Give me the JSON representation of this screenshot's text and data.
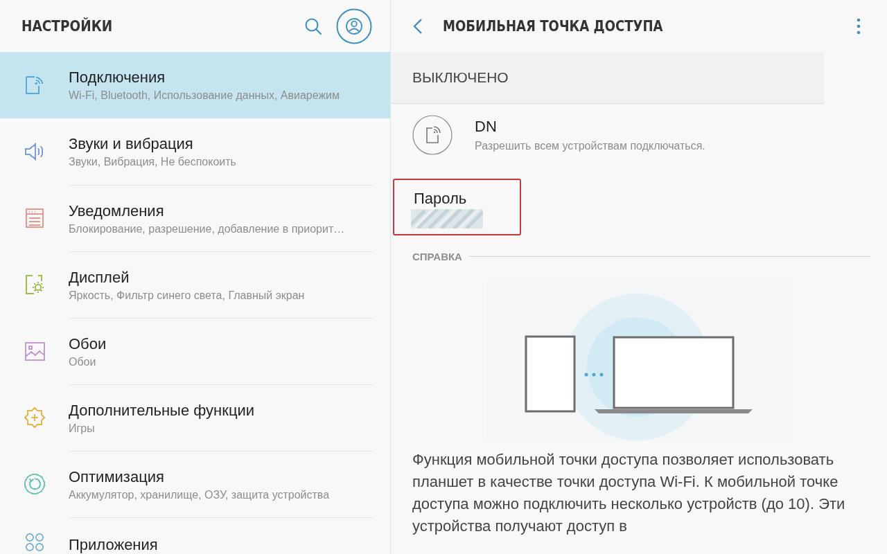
{
  "header": {
    "title": "НАСТРОЙКИ"
  },
  "sidebar": {
    "items": [
      {
        "kind": "connections",
        "title": "Подключения",
        "subtitle": "Wi-Fi, Bluetooth, Использование данных, Авиарежим",
        "color": "#5aa9d6",
        "selected": true
      },
      {
        "kind": "sound",
        "title": "Звуки и вибрация",
        "subtitle": "Звуки, Вибрация, Не беспокоить",
        "color": "#7f9bd6",
        "selected": false
      },
      {
        "kind": "notifications",
        "title": "Уведомления",
        "subtitle": "Блокирование, разрешение, добавление в приорит…",
        "color": "#e8968e",
        "selected": false
      },
      {
        "kind": "display",
        "title": "Дисплей",
        "subtitle": "Яркость, Фильтр синего света, Главный экран",
        "color": "#9cbf45",
        "selected": false
      },
      {
        "kind": "wallpaper",
        "title": "Обои",
        "subtitle": "Обои",
        "color": "#c59bd4",
        "selected": false
      },
      {
        "kind": "advanced",
        "title": "Дополнительные функции",
        "subtitle": "Игры",
        "color": "#e8b54c",
        "selected": false
      },
      {
        "kind": "optimization",
        "title": "Оптимизация",
        "subtitle": "Аккумулятор, хранилище, ОЗУ, защита устройства",
        "color": "#6cc7b4",
        "selected": false
      },
      {
        "kind": "apps",
        "title": "Приложения",
        "color": "#7eb6da",
        "selected": false
      }
    ]
  },
  "detail": {
    "title": "МОБИЛЬНАЯ ТОЧКА ДОСТУПА",
    "status": "ВЫКЛЮЧЕНО",
    "network": {
      "name": "DN",
      "subtitle": "Разрешить всем устройствам подключаться."
    },
    "password": {
      "label": "Пароль"
    },
    "help": {
      "heading": "СПРАВКА",
      "description": "Функция мобильной точки доступа позволяет использовать планшет в качестве точки доступа Wi-Fi. К мобильной точке доступа можно подключить несколько устройств (до 10). Эти устройства получают доступ в"
    }
  }
}
